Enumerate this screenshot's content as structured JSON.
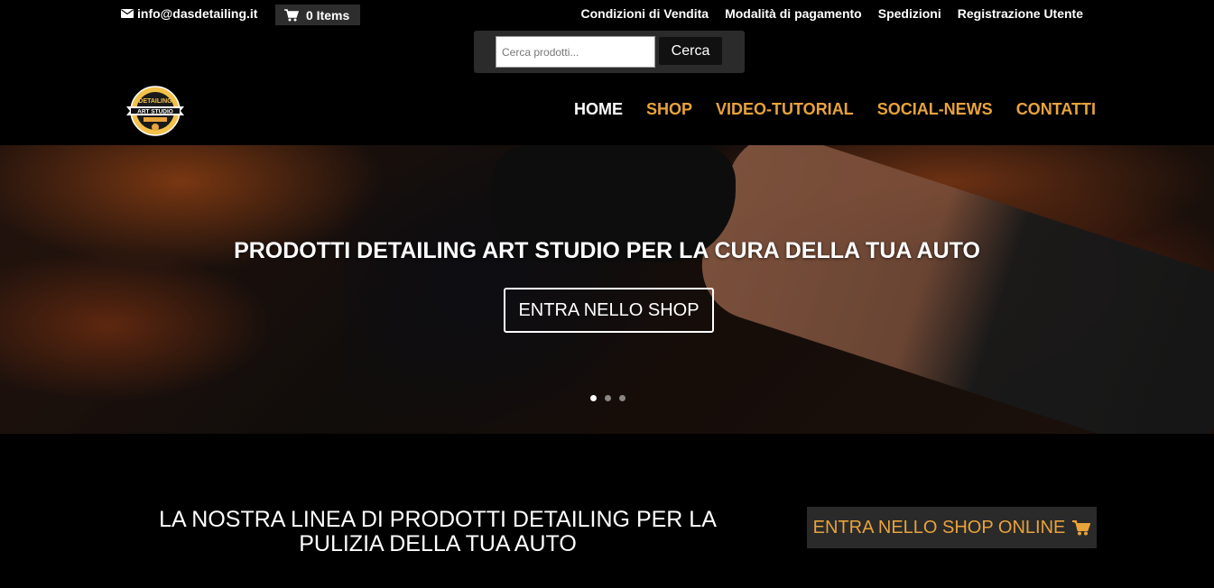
{
  "topbar": {
    "email": "info@dasdetailing.it",
    "cart_label": "0 Items",
    "links": [
      "Condizioni di Vendita",
      "Modalità di pagamento",
      "Spedizioni",
      "Registrazione Utente"
    ]
  },
  "search": {
    "placeholder": "Cerca prodotti...",
    "button_label": "Cerca"
  },
  "logo": {
    "text_top": "DETAILING",
    "text_bottom": "ART STUDIO"
  },
  "nav": {
    "items": [
      {
        "label": "HOME",
        "active": true
      },
      {
        "label": "SHOP"
      },
      {
        "label": "VIDEO-TUTORIAL"
      },
      {
        "label": "SOCIAL-NEWS"
      },
      {
        "label": "CONTATTI"
      }
    ]
  },
  "hero": {
    "title": "PRODOTTI DETAILING ART STUDIO PER LA CURA DELLA TUA AUTO",
    "button_label": "ENTRA NELLO SHOP",
    "slide_count": 3,
    "active_slide": 1
  },
  "section": {
    "heading": "LA NOSTRA LINEA DI PRODOTTI  DETAILING PER LA PULIZIA DELLA TUA AUTO",
    "shop_button_label": "ENTRA NELLO SHOP ONLINE"
  },
  "colors": {
    "accent": "#e8a33b",
    "background": "#000000"
  }
}
